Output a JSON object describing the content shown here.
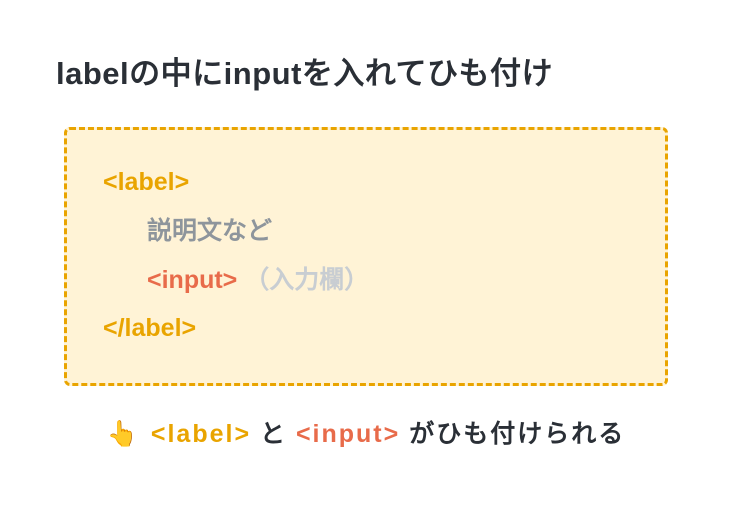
{
  "title": "labelの中にinputを入れてひも付け",
  "code": {
    "openLabel": "<label>",
    "desc": "説明文など",
    "inputTag": "<input>",
    "inputParen": "（入力欄）",
    "closeLabel": "</label>"
  },
  "footer": {
    "fingerIcon": "👆",
    "labelTag": "<label>",
    "and": " と ",
    "inputTag": "<input>",
    "tail": " がひも付けられる"
  }
}
